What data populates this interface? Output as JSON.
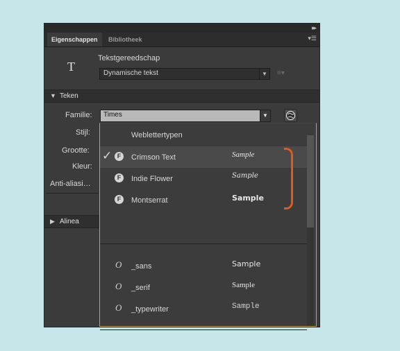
{
  "panel": {
    "tabs": [
      {
        "label": "Eigenschappen",
        "active": true
      },
      {
        "label": "Bibliotheek",
        "active": false
      }
    ],
    "tool": {
      "icon": "T",
      "title": "Tekstgereedschap",
      "text_type": "Dynamische tekst"
    },
    "sections": {
      "character": "Teken",
      "paragraph": "Alinea"
    },
    "labels": {
      "family": "Familie:",
      "style": "Stijl:",
      "size": "Grootte:",
      "color": "Kleur:",
      "anti_alias": "Anti-aliasi…"
    },
    "family_value": "Times"
  },
  "dropdown": {
    "header": "Weblettertypen",
    "web_fonts": [
      {
        "name": "Crimson Text",
        "sample": "Sample",
        "selected": true,
        "badge": "F"
      },
      {
        "name": "Indie Flower",
        "sample": "Sample",
        "selected": false,
        "badge": "F"
      },
      {
        "name": "Montserrat",
        "sample": "Sample",
        "selected": false,
        "badge": "F"
      }
    ],
    "device_fonts": [
      {
        "name": "_sans",
        "sample": "Sample",
        "badge": "O"
      },
      {
        "name": "_serif",
        "sample": "Sample",
        "badge": "O"
      },
      {
        "name": "_typewriter",
        "sample": "Sample",
        "badge": "O"
      }
    ]
  },
  "colors": {
    "background": "#c6e6ea",
    "panel": "#3b3b3b",
    "highlight_bracket": "#e2591a",
    "dropdown_border": "#c9a04a"
  }
}
